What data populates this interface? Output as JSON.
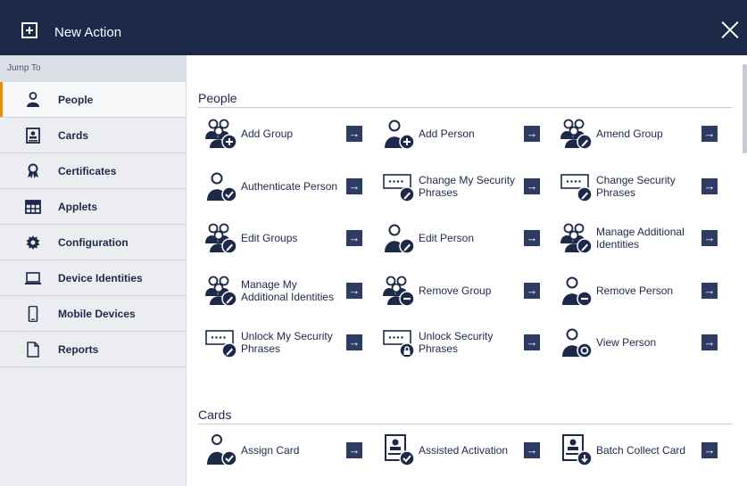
{
  "title_bar": {
    "title": "New Action"
  },
  "sidebar": {
    "jump_label": "Jump To",
    "items": [
      {
        "label": "People",
        "icon": "person-icon",
        "active": true
      },
      {
        "label": "Cards",
        "icon": "id-card-icon",
        "active": false
      },
      {
        "label": "Certificates",
        "icon": "certificate-icon",
        "active": false
      },
      {
        "label": "Applets",
        "icon": "grid-icon",
        "active": false
      },
      {
        "label": "Configuration",
        "icon": "gear-icon",
        "active": false
      },
      {
        "label": "Device Identities",
        "icon": "laptop-icon",
        "active": false
      },
      {
        "label": "Mobile Devices",
        "icon": "phone-icon",
        "active": false
      },
      {
        "label": "Reports",
        "icon": "document-icon",
        "active": false
      }
    ]
  },
  "sections": [
    {
      "title": "People",
      "actions": [
        {
          "label": "Add Group",
          "icon": "group-add-icon"
        },
        {
          "label": "Add Person",
          "icon": "person-add-icon"
        },
        {
          "label": "Amend Group",
          "icon": "group-edit-icon"
        },
        {
          "label": "Authenticate Person",
          "icon": "person-check-icon"
        },
        {
          "label": "Change My Security Phrases",
          "icon": "password-edit-icon"
        },
        {
          "label": "Change Security Phrases",
          "icon": "password-edit-icon"
        },
        {
          "label": "Edit Groups",
          "icon": "group-edit-icon"
        },
        {
          "label": "Edit Person",
          "icon": "person-edit-icon"
        },
        {
          "label": "Manage Additional Identities",
          "icon": "group-edit-icon"
        },
        {
          "label": "Manage My Additional Identities",
          "icon": "group-edit-icon"
        },
        {
          "label": "Remove Group",
          "icon": "group-remove-icon"
        },
        {
          "label": "Remove Person",
          "icon": "person-remove-icon"
        },
        {
          "label": "Unlock My Security Phrases",
          "icon": "password-edit-icon"
        },
        {
          "label": "Unlock Security Phrases",
          "icon": "password-lock-icon"
        },
        {
          "label": "View Person",
          "icon": "person-view-icon"
        }
      ]
    },
    {
      "title": "Cards",
      "actions": [
        {
          "label": "Assign Card",
          "icon": "person-card-icon"
        },
        {
          "label": "Assisted Activation",
          "icon": "card-check-icon"
        },
        {
          "label": "Batch Collect Card",
          "icon": "card-download-icon"
        }
      ]
    }
  ],
  "colors": {
    "header": "#1d2949",
    "accent": "#f08c00",
    "button": "#2e3c63"
  }
}
